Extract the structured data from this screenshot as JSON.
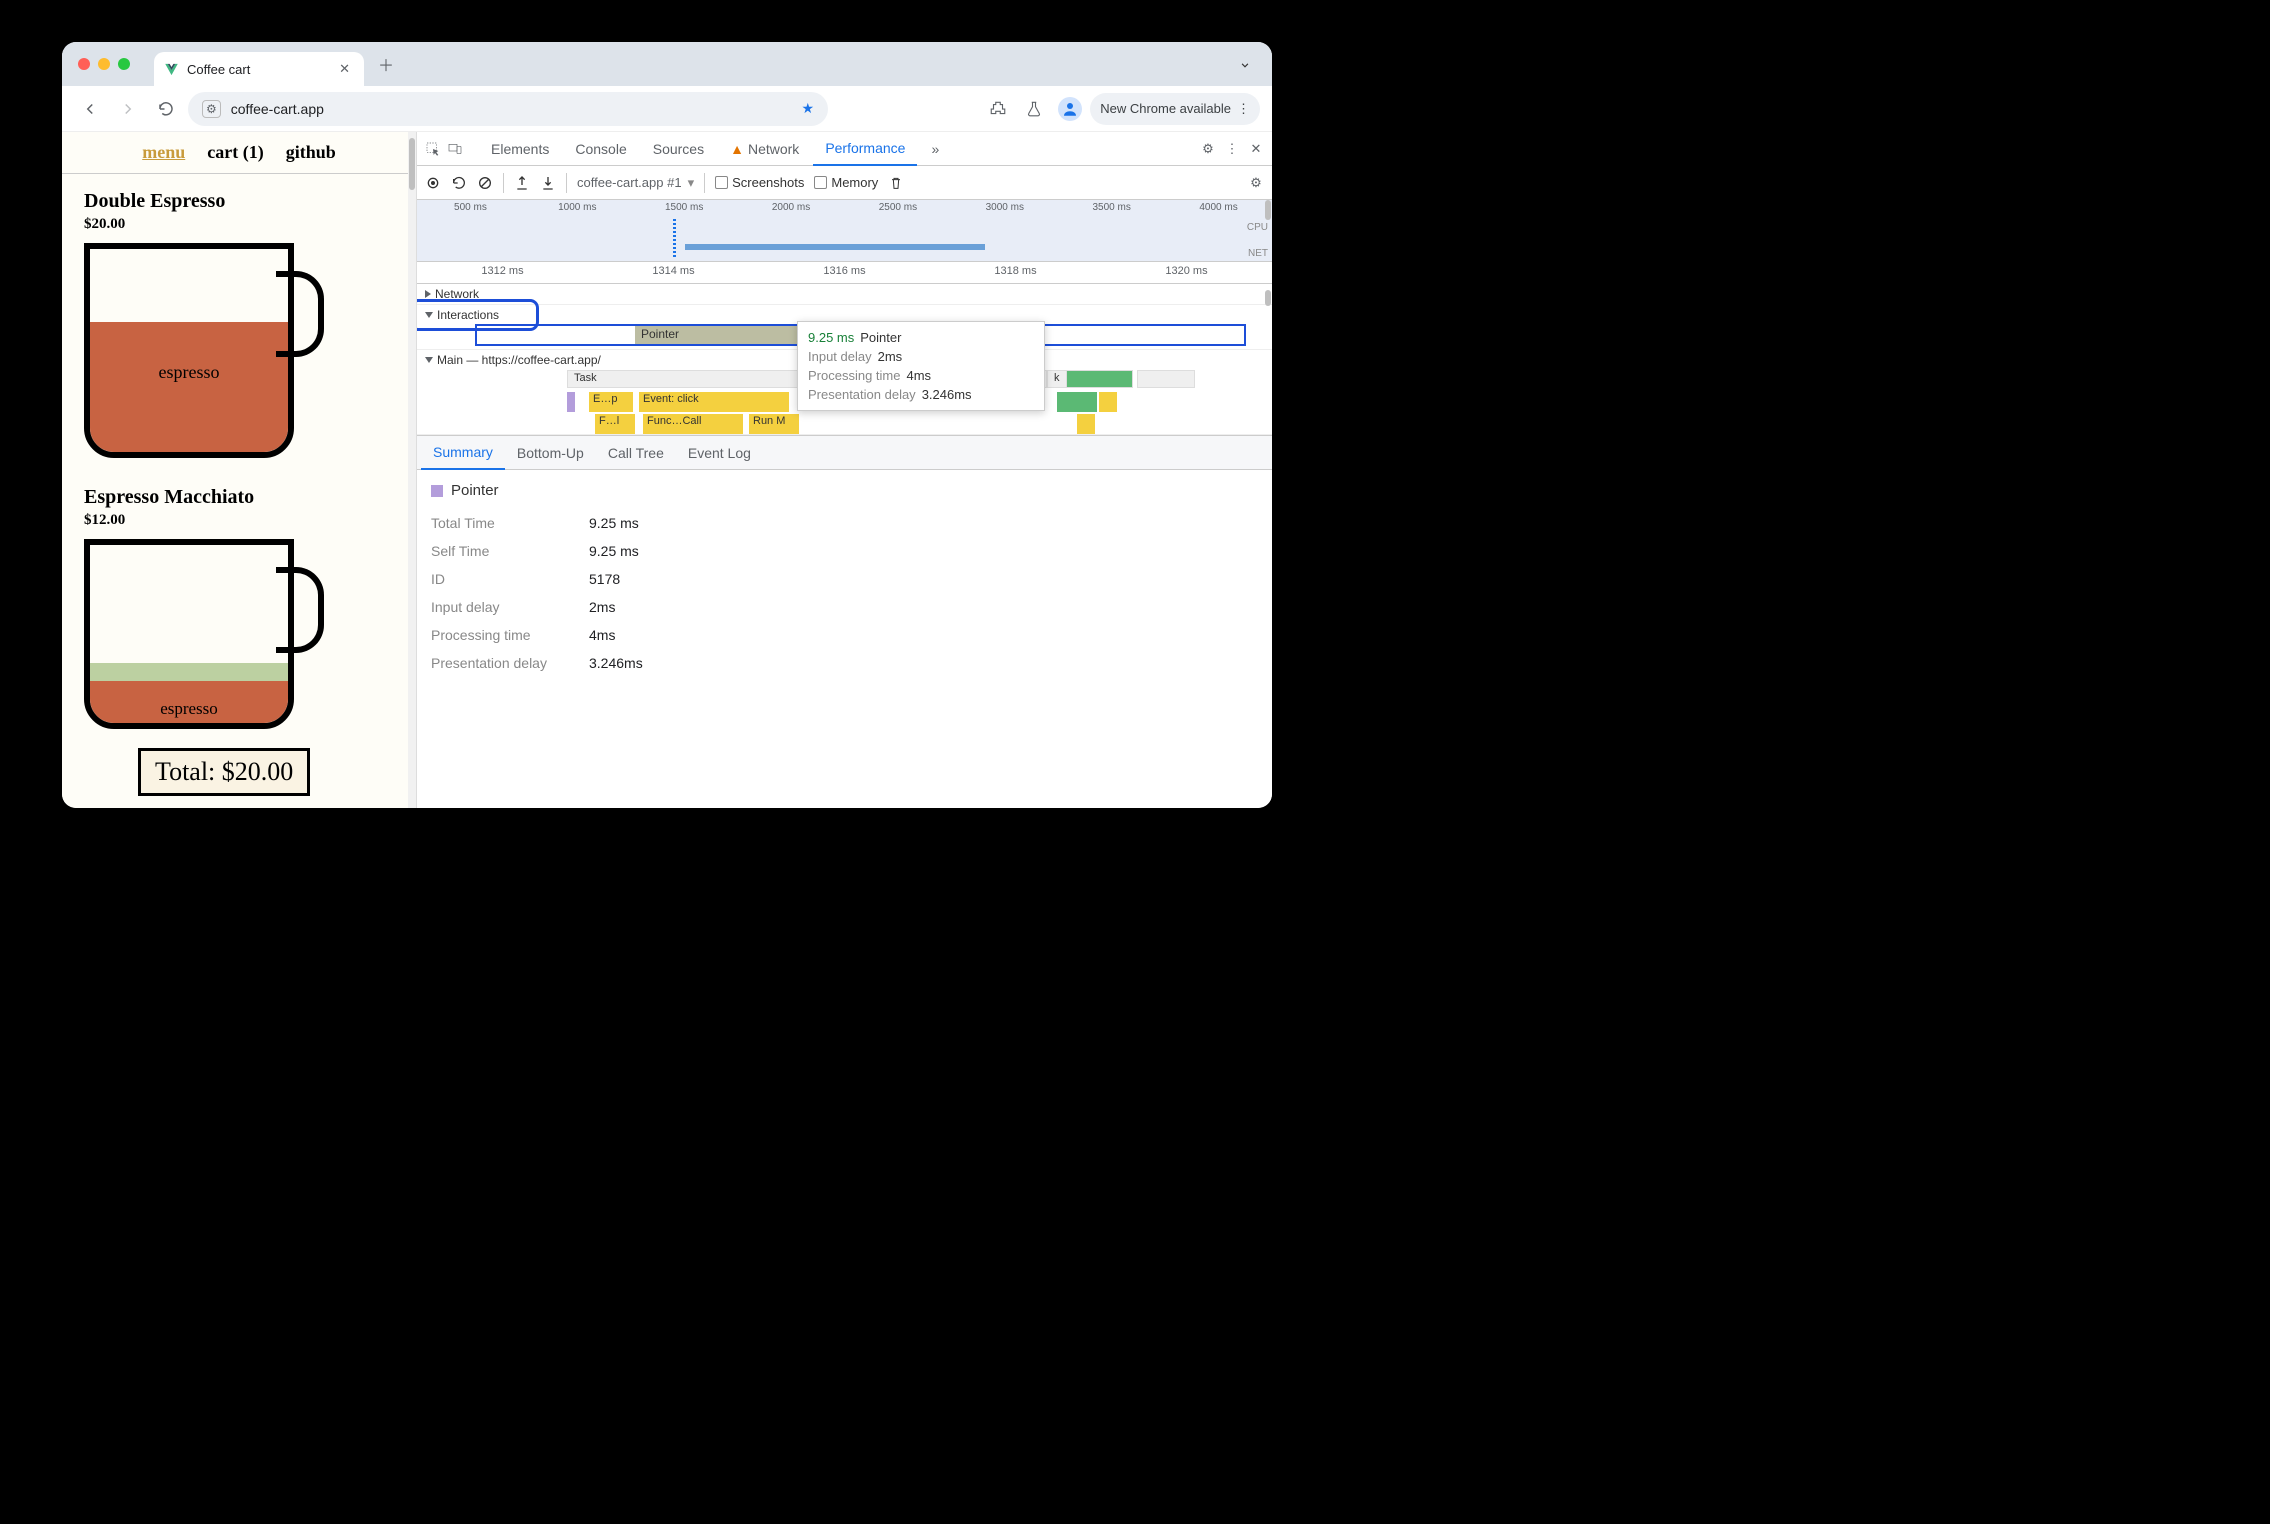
{
  "browser": {
    "tab_title": "Coffee cart",
    "url": "coffee-cart.app",
    "update_chip": "New Chrome available"
  },
  "page": {
    "nav": {
      "menu": "menu",
      "cart": "cart (1)",
      "github": "github"
    },
    "item1": {
      "name": "Double Espresso",
      "price": "$20.00",
      "label": "espresso"
    },
    "item2": {
      "name": "Espresso Macchiato",
      "price": "$12.00",
      "label": "espresso"
    },
    "total": "Total: $20.00"
  },
  "devtools": {
    "tabs": {
      "elements": "Elements",
      "console": "Console",
      "sources": "Sources",
      "network": "Network",
      "performance": "Performance"
    },
    "toolbar": {
      "target": "coffee-cart.app #1",
      "screenshots": "Screenshots",
      "memory": "Memory"
    },
    "overview_ticks": [
      "500 ms",
      "1000 ms",
      "1500 ms",
      "2000 ms",
      "2500 ms",
      "3000 ms",
      "3500 ms",
      "4000 ms"
    ],
    "overview_labels": {
      "cpu": "CPU",
      "net": "NET"
    },
    "ruler": [
      "1312 ms",
      "1314 ms",
      "1316 ms",
      "1318 ms",
      "1320 ms"
    ],
    "tracks": {
      "network": "Network",
      "interactions": "Interactions",
      "interaction_bar": "Pointer",
      "main": "Main — https://coffee-cart.app/",
      "task": "Task",
      "ev_ep": "E…p",
      "ev_click": "Event: click",
      "ev_fi": "F…l",
      "ev_fcall": "Func…Call",
      "ev_runm": "Run M",
      "task_k": "k"
    },
    "tooltip": {
      "ms": "9.25 ms",
      "title": "Pointer",
      "r1k": "Input delay",
      "r1v": "2ms",
      "r2k": "Processing time",
      "r2v": "4ms",
      "r3k": "Presentation delay",
      "r3v": "3.246ms"
    },
    "bottom_tabs": {
      "summary": "Summary",
      "bottomup": "Bottom-Up",
      "calltree": "Call Tree",
      "eventlog": "Event Log"
    },
    "summary": {
      "title": "Pointer",
      "rows": [
        {
          "k": "Total Time",
          "v": "9.25 ms"
        },
        {
          "k": "Self Time",
          "v": "9.25 ms"
        },
        {
          "k": "ID",
          "v": "5178"
        },
        {
          "k": "Input delay",
          "v": "2ms"
        },
        {
          "k": "Processing time",
          "v": "4ms"
        },
        {
          "k": "Presentation delay",
          "v": "3.246ms"
        }
      ]
    }
  }
}
